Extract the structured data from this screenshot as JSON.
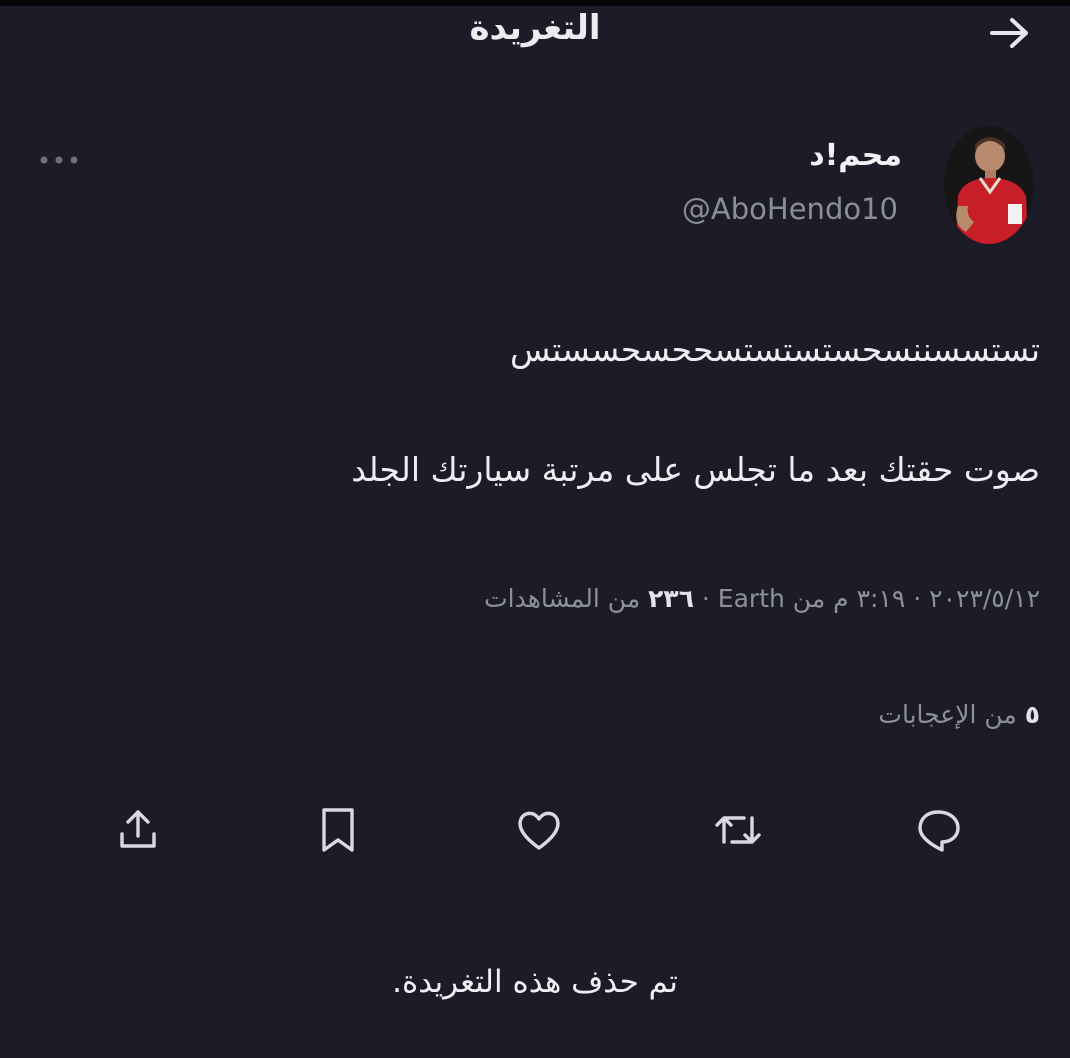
{
  "header": {
    "title": "التغريدة"
  },
  "tweet": {
    "display_name": "محم!د",
    "handle": "@AboHendo10",
    "text_line1": "تستسسننسحستستستسححسحسستس",
    "text_line2": "صوت حقتك بعد ما تجلس على مرتبة سيارتك الجلد",
    "meta_prefix": "٢٠٢٣/٥/١٢ · ٣:١٩ م من Earth · ",
    "views_count": "٢٣٦",
    "views_label": " من المشاهدات",
    "likes_count": "٥",
    "likes_label": " من الإعجابات"
  },
  "footer": {
    "deleted_notice": "تم حذف هذه التغريدة."
  },
  "icons": {
    "back": "arrow-right-icon",
    "more": "more-dots-icon",
    "share": "share-icon",
    "bookmark": "bookmark-icon",
    "like": "heart-icon",
    "retweet": "retweet-icon",
    "reply": "reply-icon"
  },
  "colors": {
    "background": "#1b1c28",
    "muted": "#8d8f9a",
    "text": "#ececf0",
    "jersey": "#c81e28"
  }
}
